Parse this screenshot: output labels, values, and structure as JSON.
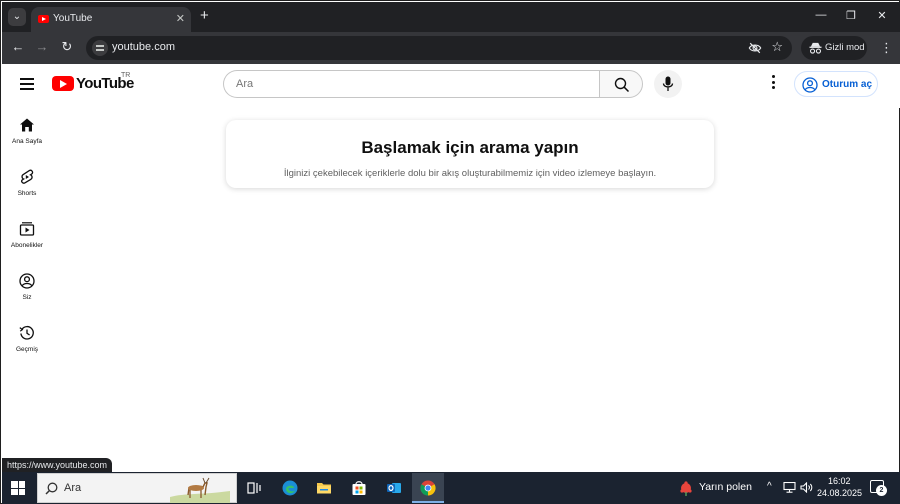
{
  "browser": {
    "tab": {
      "title": "YouTube"
    },
    "omnibox": {
      "url": "youtube.com"
    },
    "incognito_label": "Gizli mod",
    "status_url": "https://www.youtube.com"
  },
  "youtube": {
    "logo_text": "YouTube",
    "country_code": "TR",
    "search_placeholder": "Ara",
    "signin_label": "Oturum aç",
    "guide": [
      {
        "label": "Ana Sayfa",
        "icon": "home-icon"
      },
      {
        "label": "Shorts",
        "icon": "shorts-icon"
      },
      {
        "label": "Abonelikler",
        "icon": "subscriptions-icon"
      },
      {
        "label": "Siz",
        "icon": "you-icon"
      },
      {
        "label": "Geçmiş",
        "icon": "history-icon"
      }
    ],
    "prompt": {
      "title": "Başlamak için arama yapın",
      "subtitle": "İlginizi çekebilecek içeriklerle dolu bir akış oluşturabilmemiz için video izlemeye başlayın."
    }
  },
  "taskbar": {
    "search_label": "Ara",
    "weather_label": "Yarın polen",
    "clock_time": "16:02",
    "clock_date": "24.08.2025",
    "notification_count": "2",
    "apps": [
      "task-view",
      "edge",
      "file-explorer",
      "microsoft-store",
      "outlook",
      "chrome"
    ]
  },
  "colors": {
    "youtube_red": "#ff0000",
    "signin_blue": "#065fd4",
    "chrome_dark": "#202124",
    "taskbar": "#1b2330"
  }
}
